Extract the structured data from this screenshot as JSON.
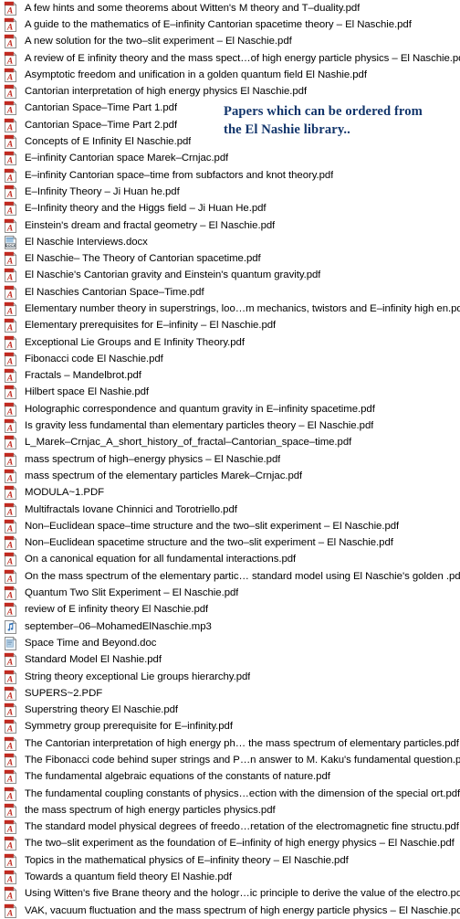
{
  "window": {
    "view_mode": "list",
    "background_color": "#ffffff",
    "text_color": "#000000"
  },
  "annotation": {
    "color": "#12356b",
    "line1": "Papers which can be ordered from",
    "line2": "the El Nashie library.."
  },
  "icons": {
    "pdf": "pdf-file-icon",
    "docx": "docx-file-icon",
    "doc": "doc-file-icon",
    "mp3": "mp3-audio-file-icon"
  },
  "files": [
    {
      "name": "A few hints and some theorems about Witten's M theory and T–duality.pdf",
      "type": "pdf"
    },
    {
      "name": "A guide to the mathematics of E–infinity Cantorian spacetime theory – El Naschie.pdf",
      "type": "pdf"
    },
    {
      "name": "A new solution for the two–slit experiment – El Naschie.pdf",
      "type": "pdf"
    },
    {
      "name": "A review of E infinity theory and the mass spect…of high energy particle physics – El Naschie.pdf",
      "type": "pdf"
    },
    {
      "name": "Asymptotic freedom and unification in a golden quantum field El Nashie.pdf",
      "type": "pdf"
    },
    {
      "name": "Cantorian interpretation of high energy physics El Naschie.pdf",
      "type": "pdf"
    },
    {
      "name": "Cantorian Space–Time Part 1.pdf",
      "type": "pdf"
    },
    {
      "name": "Cantorian Space–Time Part 2.pdf",
      "type": "pdf"
    },
    {
      "name": "Concepts of E Infinity El Naschie.pdf",
      "type": "pdf"
    },
    {
      "name": "E–infinity Cantorian space Marek–Crnjac.pdf",
      "type": "pdf"
    },
    {
      "name": "E–infinity Cantorian space–time from subfactors and knot theory.pdf",
      "type": "pdf"
    },
    {
      "name": "E–Infinity Theory – Ji Huan he.pdf",
      "type": "pdf"
    },
    {
      "name": "E–Infinity theory and the Higgs field – Ji Huan He.pdf",
      "type": "pdf"
    },
    {
      "name": "Einstein's dream and fractal geometry – El Naschie.pdf",
      "type": "pdf"
    },
    {
      "name": "El Naschie Interviews.docx",
      "type": "docx"
    },
    {
      "name": "El Naschie– The Theory of Cantorian spacetime.pdf",
      "type": "pdf"
    },
    {
      "name": "El Naschie's Cantorian gravity and Einstein's quantum gravity.pdf",
      "type": "pdf"
    },
    {
      "name": "El Naschies Cantorian Space–Time.pdf",
      "type": "pdf"
    },
    {
      "name": "Elementary number theory in superstrings, loo…m mechanics, twistors and E–infinity high en.pdf",
      "type": "pdf"
    },
    {
      "name": "Elementary prerequisites for E–infinity – El Naschie.pdf",
      "type": "pdf"
    },
    {
      "name": "Exceptional Lie Groups and E Infinity Theory.pdf",
      "type": "pdf"
    },
    {
      "name": "Fibonacci code El Naschie.pdf",
      "type": "pdf"
    },
    {
      "name": "Fractals – Mandelbrot.pdf",
      "type": "pdf"
    },
    {
      "name": "Hilbert space El Nashie.pdf",
      "type": "pdf"
    },
    {
      "name": "Holographic correspondence and quantum gravity in E–infinity spacetime.pdf",
      "type": "pdf"
    },
    {
      "name": "Is gravity less fundamental than elementary particles theory – El Naschie.pdf",
      "type": "pdf"
    },
    {
      "name": "L_Marek–Crnjac_A_short_history_of_fractal–Cantorian_space–time.pdf",
      "type": "pdf"
    },
    {
      "name": "mass spectrum of high–energy physics – El Naschie.pdf",
      "type": "pdf"
    },
    {
      "name": "mass spectrum of the elementary particles Marek–Crnjac.pdf",
      "type": "pdf"
    },
    {
      "name": "MODULA~1.PDF",
      "type": "pdf"
    },
    {
      "name": "Multifractals Iovane Chinnici and Torotriello.pdf",
      "type": "pdf"
    },
    {
      "name": "Non–Euclidean space–time structure and the two–slit experiment – El Naschie.pdf",
      "type": "pdf"
    },
    {
      "name": "Non–Euclidean spacetime structure and the two–slit experiment – El Naschie.pdf",
      "type": "pdf"
    },
    {
      "name": "On a canonical equation for all fundamental interactions.pdf",
      "type": "pdf"
    },
    {
      "name": "On the mass spectrum of the elementary partic… standard model using El Naschie's golden .pdf",
      "type": "pdf"
    },
    {
      "name": "Quantum Two Slit Experiment – El Naschie.pdf",
      "type": "pdf"
    },
    {
      "name": "review of E infinity theory El Naschie.pdf",
      "type": "pdf"
    },
    {
      "name": "september–06–MohamedElNaschie.mp3",
      "type": "mp3"
    },
    {
      "name": "Space Time and Beyond.doc",
      "type": "doc"
    },
    {
      "name": "Standard Model El Nashie.pdf",
      "type": "pdf"
    },
    {
      "name": "String theory exceptional Lie groups hierarchy.pdf",
      "type": "pdf"
    },
    {
      "name": "SUPERS~2.PDF",
      "type": "pdf"
    },
    {
      "name": "Superstring theory El Naschie.pdf",
      "type": "pdf"
    },
    {
      "name": "Symmetry group prerequisite for E–infinity.pdf",
      "type": "pdf"
    },
    {
      "name": "The Cantorian interpretation of high energy ph… the mass spectrum of elementary particles.pdf",
      "type": "pdf"
    },
    {
      "name": "The Fibonacci code behind super strings and P…n answer to M. Kaku's fundamental question.pdf",
      "type": "pdf"
    },
    {
      "name": "The fundamental algebraic equations of the constants of nature.pdf",
      "type": "pdf"
    },
    {
      "name": "The fundamental coupling constants of physics…ection with the dimension of the special ort.pdf",
      "type": "pdf"
    },
    {
      "name": "the mass spectrum of high energy particles physics.pdf",
      "type": "pdf"
    },
    {
      "name": "The standard model physical degrees of freedo…retation of the electromagnetic fine structu.pdf",
      "type": "pdf"
    },
    {
      "name": "The two–slit experiment as the foundation of E–infinity of high energy physics – El Naschie.pdf",
      "type": "pdf"
    },
    {
      "name": "Topics in the mathematical physics of E–infinity theory – El Naschie.pdf",
      "type": "pdf"
    },
    {
      "name": "Towards a quantum field theory El Nashie.pdf",
      "type": "pdf"
    },
    {
      "name": "Using Witten's five Brane theory and the hologr…ic principle to derive the value of the electro.pdf",
      "type": "pdf"
    },
    {
      "name": "VAK, vacuum fluctuation and the mass spectrum of high energy particle physics – El Naschie.pdf",
      "type": "pdf"
    }
  ]
}
